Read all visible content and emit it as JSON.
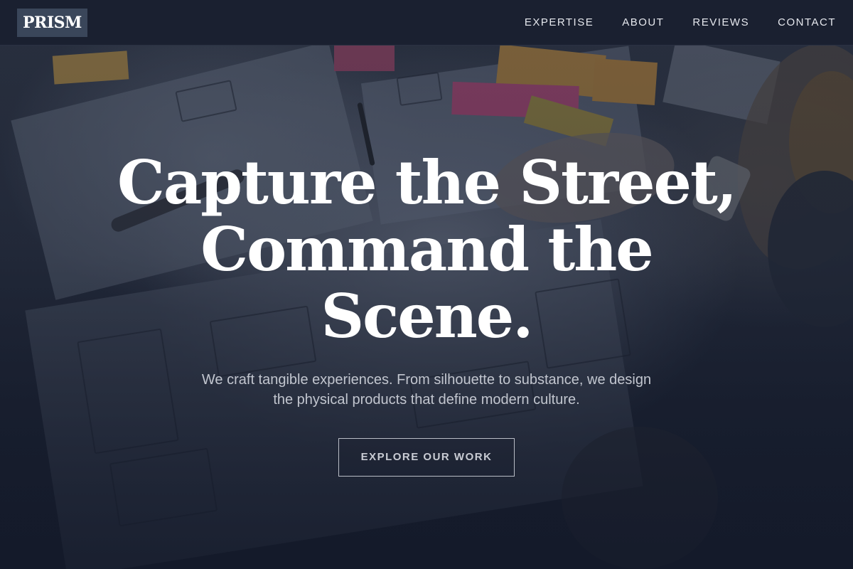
{
  "brand": {
    "logo": "PRISM"
  },
  "nav": {
    "items": [
      {
        "label": "EXPERTISE"
      },
      {
        "label": "ABOUT"
      },
      {
        "label": "REVIEWS"
      },
      {
        "label": "CONTACT"
      }
    ]
  },
  "hero": {
    "headline": "Capture the Street, Command the Scene.",
    "subtitle": "We craft tangible experiences. From silhouette to substance, we design the physical products that define modern culture.",
    "cta_label": "EXPLORE OUR WORK"
  },
  "colors": {
    "header_bg": "#1a2030",
    "logo_bg": "#3a465a",
    "headline": "#ffffff",
    "subtitle": "#c2c6cf"
  }
}
